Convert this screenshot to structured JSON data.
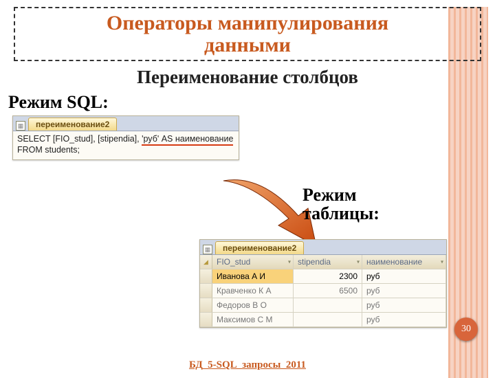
{
  "title": {
    "line1": "Операторы манипулирования",
    "line2": "данными"
  },
  "subtitle": "Переименование столбцов",
  "sql_label": "Режим SQL:",
  "sql_tab": "переименование2",
  "sql_line1_pre": "SELECT [FIO_stud], [stipendia], ",
  "sql_line1_hl": "'руб' AS наименование",
  "sql_line2": "FROM students;",
  "table_label_ln1": "Режим",
  "table_label_ln2": "таблицы:",
  "table_tab": "переименование2",
  "columns": {
    "c1": "FIO_stud",
    "c2": "stipendia",
    "c3": "наименование"
  },
  "rows": [
    {
      "fio": "Иванова А И",
      "stip": "2300",
      "name": "руб"
    },
    {
      "fio": "Кравченко К А",
      "stip": "6500",
      "name": "руб"
    },
    {
      "fio": "Федоров В О",
      "stip": "",
      "name": "руб"
    },
    {
      "fio": "Максимов С М",
      "stip": "",
      "name": "руб"
    }
  ],
  "footer_label": "БД_5-SQL_запросы_2011",
  "page_number": "30"
}
